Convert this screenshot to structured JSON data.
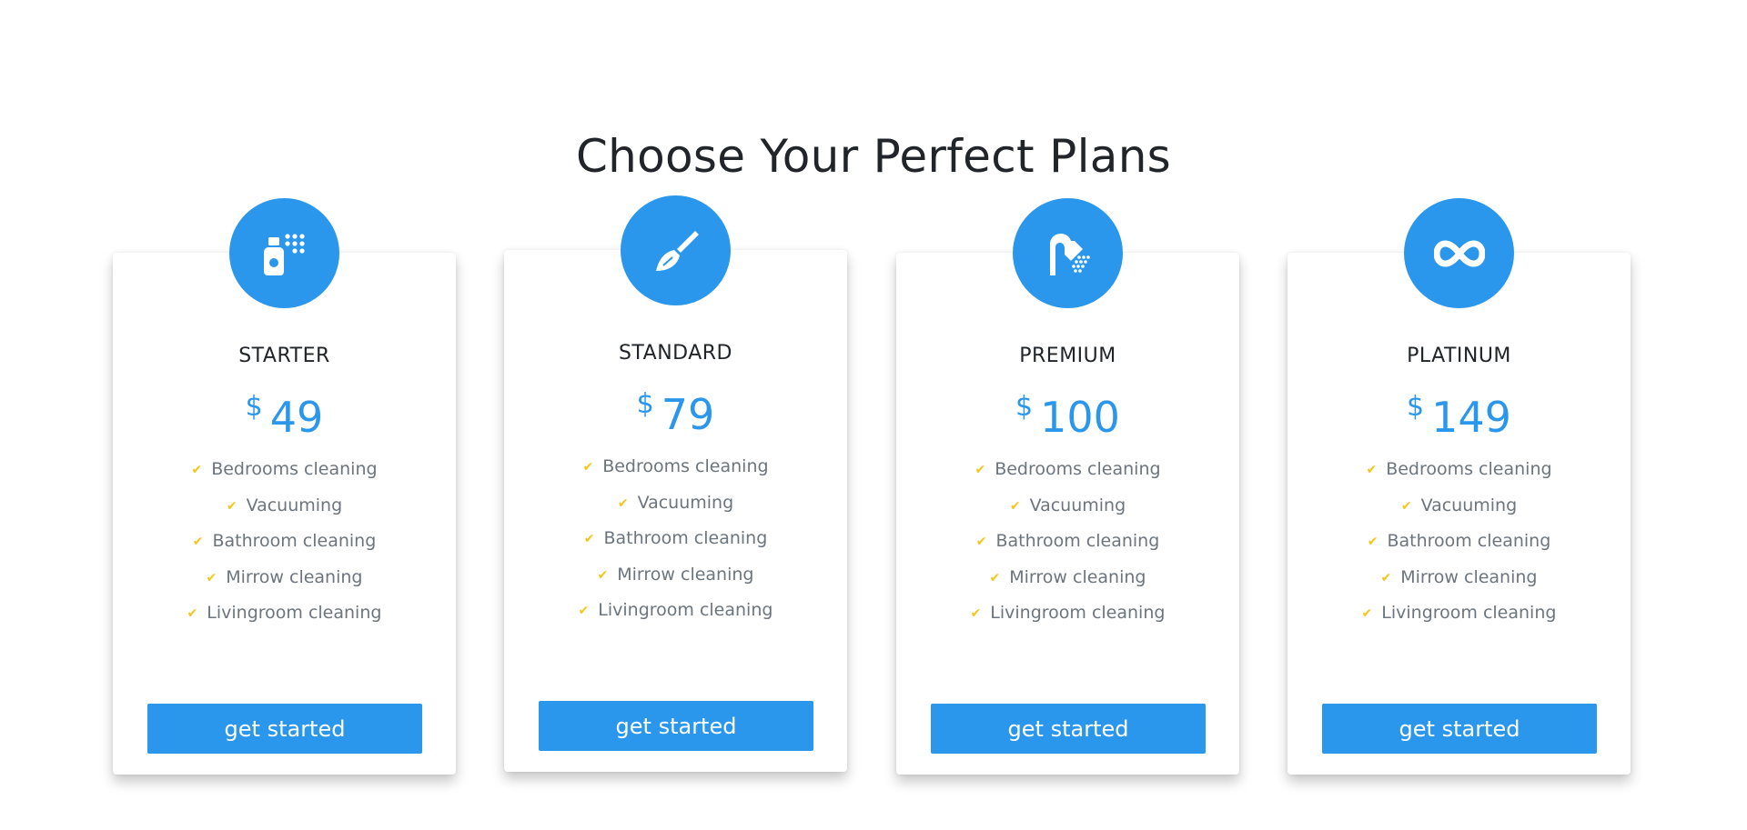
{
  "section": {
    "title": "Choose Your Perfect Plans"
  },
  "colors": {
    "accent": "#2b97ec",
    "check": "#f5c518",
    "title_text": "#212529",
    "feature_text": "#6c757d"
  },
  "plans": [
    {
      "name": "STARTER",
      "currency": "$",
      "price": "49",
      "icon": "spray-bottle-icon",
      "features": [
        "Bedrooms cleaning",
        "Vacuuming",
        "Bathroom cleaning",
        "Mirrow cleaning",
        "Livingroom cleaning"
      ],
      "button_label": "get started"
    },
    {
      "name": "STANDARD",
      "currency": "$",
      "price": "79",
      "icon": "broom-icon",
      "features": [
        "Bedrooms cleaning",
        "Vacuuming",
        "Bathroom cleaning",
        "Mirrow cleaning",
        "Livingroom cleaning"
      ],
      "button_label": "get started"
    },
    {
      "name": "PREMIUM",
      "currency": "$",
      "price": "100",
      "icon": "shower-icon",
      "features": [
        "Bedrooms cleaning",
        "Vacuuming",
        "Bathroom cleaning",
        "Mirrow cleaning",
        "Livingroom cleaning"
      ],
      "button_label": "get started"
    },
    {
      "name": "PLATINUM",
      "currency": "$",
      "price": "149",
      "icon": "infinity-icon",
      "features": [
        "Bedrooms cleaning",
        "Vacuuming",
        "Bathroom cleaning",
        "Mirrow cleaning",
        "Livingroom cleaning"
      ],
      "button_label": "get started"
    }
  ]
}
